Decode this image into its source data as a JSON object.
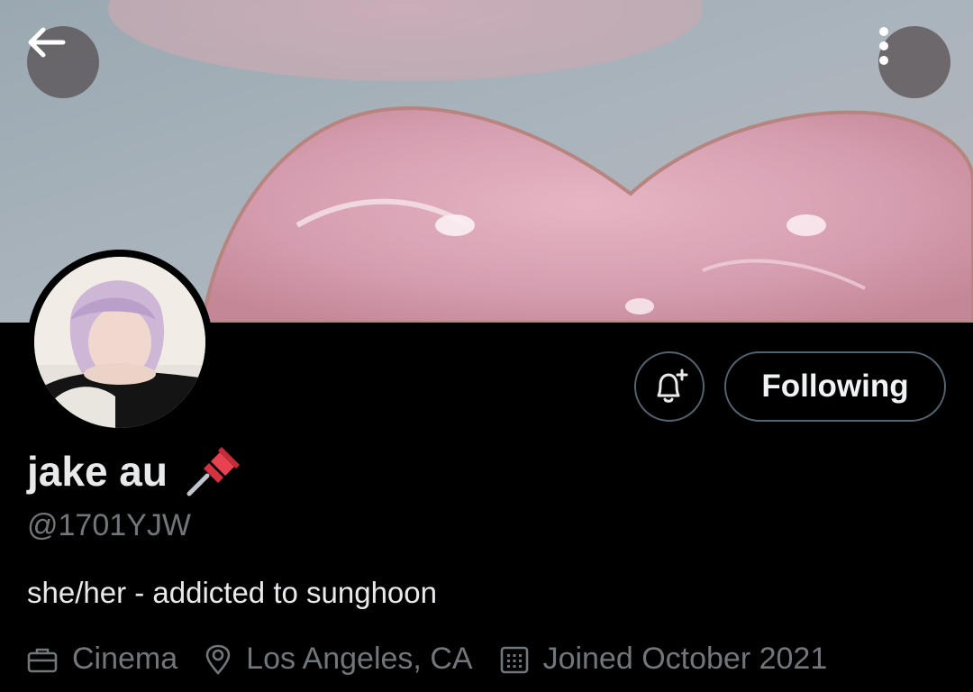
{
  "header": {
    "back_icon": "arrow-left-icon",
    "more_icon": "more-vertical-icon"
  },
  "profile": {
    "display_name": "jake au",
    "name_emoji": "pushpin-icon",
    "handle": "@1701YJW",
    "bio": "she/her - addicted to sunghoon",
    "category": "Cinema",
    "location": "Los Angeles, CA",
    "joined": "Joined October 2021"
  },
  "actions": {
    "notify_icon": "bell-plus-icon",
    "following_label": "Following"
  },
  "colors": {
    "background": "#000000",
    "primary_text": "#e7e9ea",
    "secondary_text": "#71767b",
    "button_border": "#536471",
    "banner_accent": "#d9a3b2"
  }
}
